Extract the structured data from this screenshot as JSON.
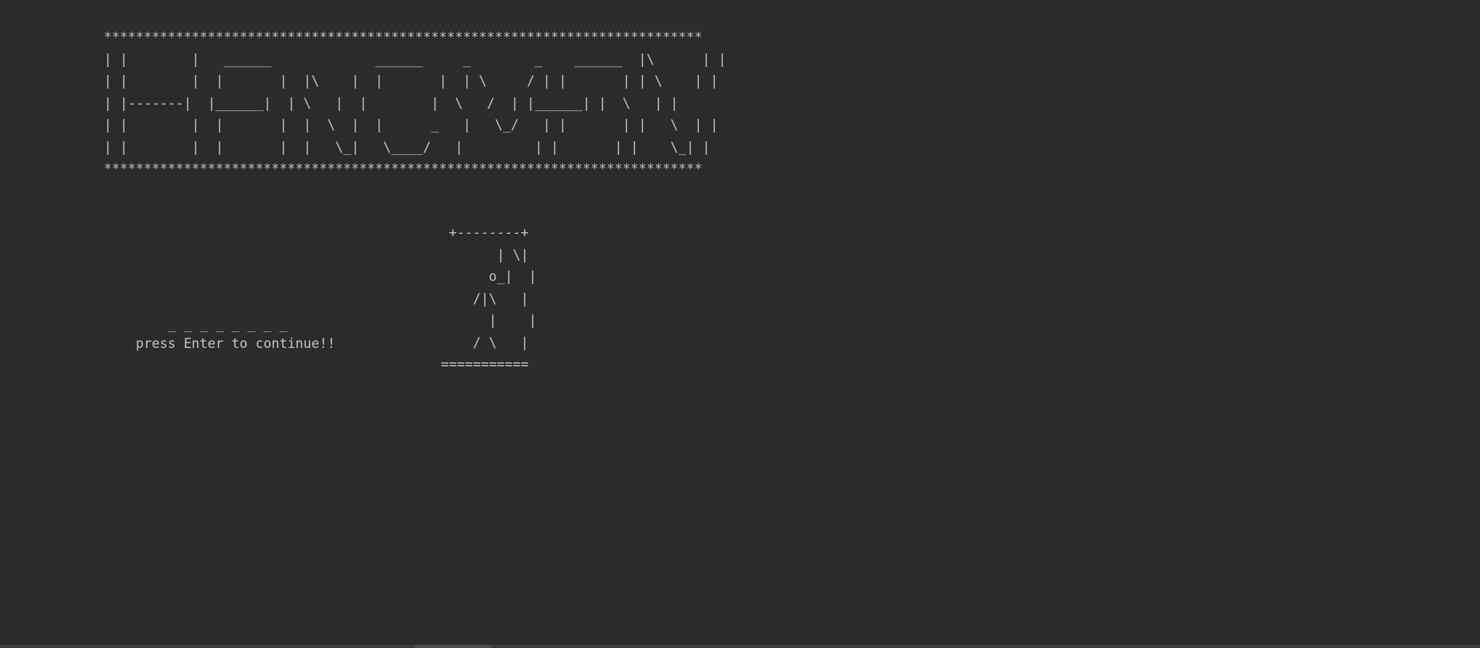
{
  "console": {
    "banner": [
      "***************************************************************************",
      "| |        |   ______             ______     _        _    ______  |\\      | |",
      "| |        |  |       |  |\\    |  |       |  | \\     / | |       | | \\    | |",
      "| |-------|  |______|  | \\   |  |        |  \\   /  | |______| |  \\   | |",
      "| |        |  |       |  |  \\  |  |      _   |   \\_/   | |       | |   \\  | |",
      "| |        |  |       |  |   \\_|   \\____/   |         | |       | |    \\_| |",
      "***************************************************************************"
    ],
    "gallows": [
      "+--------+",
      "     | \\|",
      "   o_|  |",
      "  /|\\   |",
      "   |    |",
      "  / \\   |",
      "==========="
    ],
    "word_blanks": "_ _ _ _ _ _ _ _",
    "prompt": "press Enter to continue!!"
  },
  "colors": {
    "background": "#2b2b2b",
    "text": "#c4c4c4",
    "scrollbar_track": "#3a3a3a",
    "scrollbar_thumb": "#4c4c4c"
  }
}
